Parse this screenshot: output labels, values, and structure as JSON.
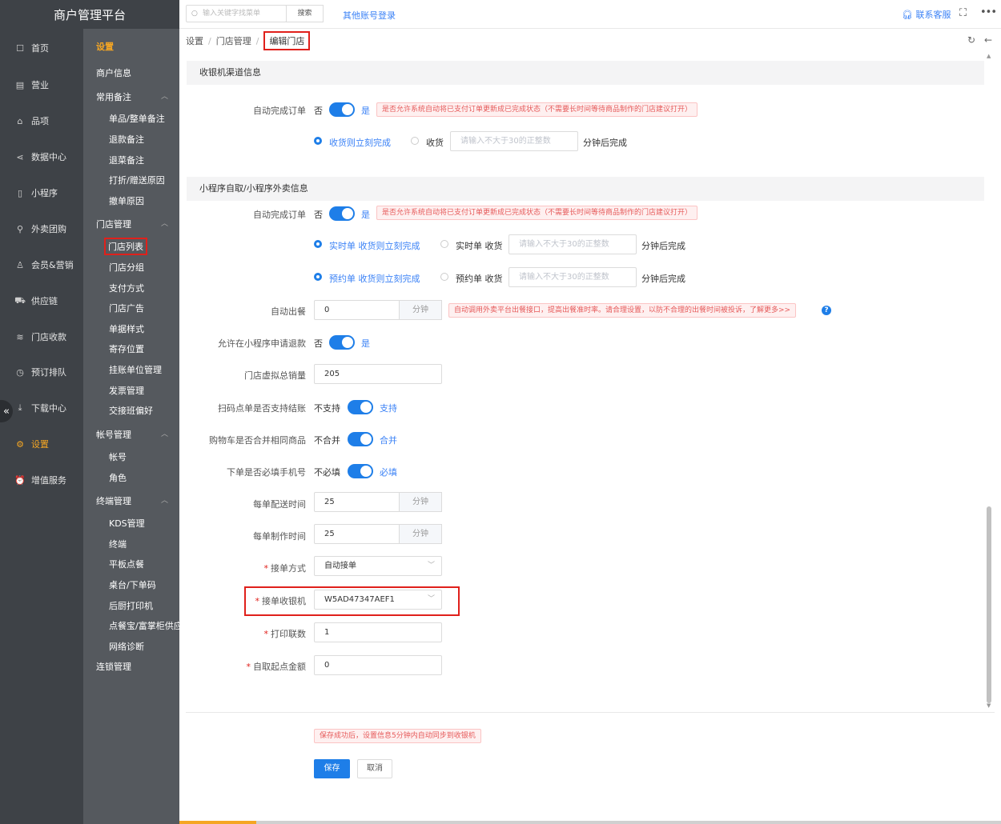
{
  "app": {
    "title": "商户管理平台"
  },
  "leftnav": {
    "items": [
      {
        "label": "首页",
        "icon": "home-icon",
        "glyph": "☐"
      },
      {
        "label": "营业",
        "icon": "calendar-icon",
        "glyph": "▤"
      },
      {
        "label": "品项",
        "icon": "bag-icon",
        "glyph": "⌂"
      },
      {
        "label": "数据中心",
        "icon": "share-icon",
        "glyph": "⋖"
      },
      {
        "label": "小程序",
        "icon": "phone-icon",
        "glyph": "▯"
      },
      {
        "label": "外卖团购",
        "icon": "bike-icon",
        "glyph": "⚲"
      },
      {
        "label": "会员&营销",
        "icon": "user-icon",
        "glyph": "♙"
      },
      {
        "label": "供应链",
        "icon": "truck-icon",
        "glyph": "⛟"
      },
      {
        "label": "门店收款",
        "icon": "database-icon",
        "glyph": "≋"
      },
      {
        "label": "预订排队",
        "icon": "clock-icon",
        "glyph": "◷"
      },
      {
        "label": "下载中心",
        "icon": "download-icon",
        "glyph": "⤓"
      },
      {
        "label": "设置",
        "icon": "gear-icon",
        "glyph": "⚙"
      },
      {
        "label": "增值服务",
        "icon": "alarm-icon",
        "glyph": "⏰"
      }
    ],
    "collapse_glyph": "«"
  },
  "subnav": {
    "title": "设置",
    "merchant_info": "商户信息",
    "groups": {
      "common_notes": "常用备注",
      "store_mgmt": "门店管理",
      "account_mgmt": "帐号管理",
      "terminal_mgmt": "终端管理"
    },
    "common_items": [
      "单品/整单备注",
      "退款备注",
      "退菜备注",
      "打折/赠送原因",
      "撤单原因"
    ],
    "store_items": [
      "门店列表",
      "门店分组",
      "支付方式",
      "门店广告",
      "单据样式",
      "寄存位置",
      "挂账单位管理",
      "发票管理",
      "交接班偏好"
    ],
    "account_items": [
      "帐号",
      "角色"
    ],
    "terminal_items": [
      "KDS管理",
      "终端",
      "平板点餐",
      "桌台/下单码",
      "后厨打印机",
      "点餐宝/富掌柜供应",
      "网络诊断"
    ],
    "chain_mgmt": "连锁管理"
  },
  "header": {
    "search_placeholder": "输入关键字找菜单",
    "search_button": "搜索",
    "other_login": "其他账号登录",
    "contact": "联系客服"
  },
  "breadcrumb": [
    "设置",
    "门店管理",
    "编辑门店"
  ],
  "cashier_section": {
    "title": "收银机渠道信息",
    "auto_complete_label": "自动完成订单",
    "no": "否",
    "yes": "是",
    "tip": "是否允许系统自动将已支付订单更新成已完成状态（不需要长时间等待商品制作的门店建议打开）",
    "opt_immediate": "收货则立刻完成",
    "opt_delay": "收货",
    "delay_placeholder": "请输入不大于30的正整数",
    "delay_suffix": "分钟后完成"
  },
  "mini_section": {
    "title": "小程序自取/小程序外卖信息",
    "auto_complete_label": "自动完成订单",
    "no": "否",
    "yes": "是",
    "tip": "是否允许系统自动将已支付订单更新成已完成状态（不需要长时间等待商品制作的门店建议打开）",
    "realtime_immediate": "实时单 收货则立刻完成",
    "realtime_delay": "实时单 收货",
    "reserve_immediate": "预约单 收货则立刻完成",
    "reserve_delay": "预约单 收货",
    "delay_placeholder": "请输入不大于30的正整数",
    "delay_suffix": "分钟后完成",
    "auto_meal_label": "自动出餐",
    "auto_meal_value": "0",
    "minute_unit": "分钟",
    "auto_meal_tip": "自动调用外卖平台出餐接口，提高出餐准时率。请合理设置，以防不合理的出餐时间被投诉，了解更多>>",
    "refund_label": "允许在小程序申请退款",
    "virtual_sales_label": "门店虚拟总销量",
    "virtual_sales_value": "205",
    "scan_settle_label": "扫码点单是否支持结账",
    "not_support": "不支持",
    "support": "支持",
    "merge_label": "购物车是否合并相同商品",
    "not_merge": "不合并",
    "merge": "合并",
    "phone_label": "下单是否必填手机号",
    "not_required": "不必填",
    "required": "必填",
    "delivery_time_label": "每单配送时间",
    "delivery_time_value": "25",
    "make_time_label": "每单制作时间",
    "make_time_value": "25",
    "accept_mode_label": "接单方式",
    "accept_mode_value": "自动接单",
    "accept_cashier_label": "接单收银机",
    "accept_cashier_value": "W5AD47347AEF1",
    "print_copies_label": "打印联数",
    "print_copies_value": "1",
    "min_amount_label": "自取起点金额",
    "min_amount_value": "0"
  },
  "footer": {
    "tip": "保存成功后，设置信息5分钟内自动同步到收银机",
    "save": "保存",
    "cancel": "取消"
  }
}
